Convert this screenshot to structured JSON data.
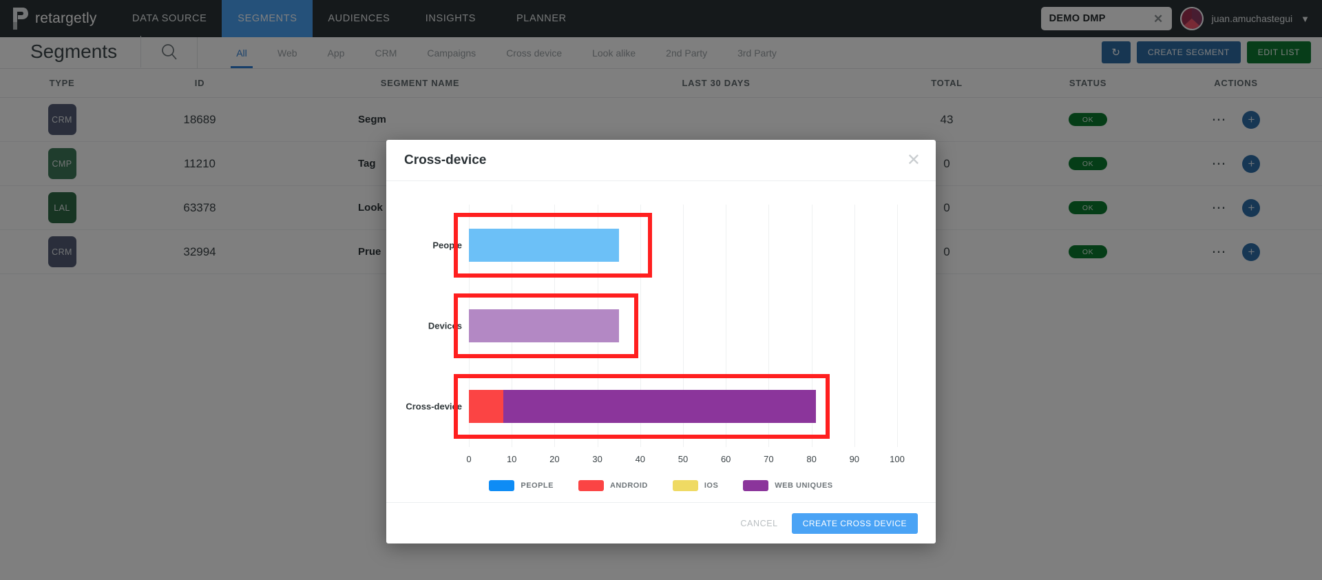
{
  "topnav": {
    "brand": "retargetly",
    "brand_icon": "retargetly-logo-icon",
    "items": [
      {
        "label": "DATA SOURCE",
        "active": false
      },
      {
        "label": "SEGMENTS",
        "active": true
      },
      {
        "label": "AUDIENCES",
        "active": false
      },
      {
        "label": "INSIGHTS",
        "active": false
      },
      {
        "label": "PLANNER",
        "active": false
      }
    ],
    "dmp_selector": {
      "value": "DEMO DMP",
      "clear_icon": "close-icon"
    },
    "user": {
      "name": "juan.amuchastegui",
      "chevron_icon": "chevron-down-icon",
      "avatar_icon": "avatar"
    }
  },
  "subheader": {
    "title": "Segments",
    "search_icon": "search-icon",
    "tabs": [
      {
        "label": "All",
        "active": true
      },
      {
        "label": "Web",
        "active": false
      },
      {
        "label": "App",
        "active": false
      },
      {
        "label": "CRM",
        "active": false
      },
      {
        "label": "Campaigns",
        "active": false
      },
      {
        "label": "Cross device",
        "active": false
      },
      {
        "label": "Look alike",
        "active": false
      },
      {
        "label": "2nd Party",
        "active": false
      },
      {
        "label": "3rd Party",
        "active": false
      }
    ],
    "refresh_icon": "refresh-icon",
    "create_segment_label": "CREATE SEGMENT",
    "edit_list_label": "EDIT LIST"
  },
  "table": {
    "columns": [
      "TYPE",
      "ID",
      "SEGMENT NAME",
      "LAST 30 DAYS",
      "TOTAL",
      "STATUS",
      "ACTIONS"
    ],
    "rows": [
      {
        "type": "CRM",
        "type_color": "#545d77",
        "id": "18689",
        "name": "Segm",
        "last30": "",
        "total": "43",
        "status": "OK"
      },
      {
        "type": "CMP",
        "type_color": "#3f7a5a",
        "id": "11210",
        "name": "Tag",
        "last30": "",
        "total": "0",
        "status": "OK"
      },
      {
        "type": "LAL",
        "type_color": "#2f6b47",
        "id": "63378",
        "name": "Look",
        "last30": "",
        "total": "0",
        "status": "OK"
      },
      {
        "type": "CRM",
        "type_color": "#545d77",
        "id": "32994",
        "name": "Prue",
        "last30": "",
        "total": "0",
        "status": "OK"
      }
    ],
    "row_menu_icon": "more-options-icon",
    "row_add_icon": "plus-icon"
  },
  "modal": {
    "title": "Cross-device",
    "close_icon": "close-icon",
    "cancel_label": "CANCEL",
    "submit_label": "CREATE CROSS DEVICE"
  },
  "chart_data": {
    "type": "bar",
    "orientation": "horizontal",
    "stacked": true,
    "title": "Cross-device",
    "categories": [
      "People",
      "Devices",
      "Cross-device"
    ],
    "xlabel": "",
    "ylabel": "",
    "xlim": [
      0,
      100
    ],
    "xticks": [
      0,
      10,
      20,
      30,
      40,
      50,
      60,
      70,
      80,
      90,
      100
    ],
    "grid": true,
    "legend": [
      {
        "name": "PEOPLE",
        "color": "#0e8cf5"
      },
      {
        "name": "ANDROID",
        "color": "#fb4444"
      },
      {
        "name": "IOS",
        "color": "#efda63"
      },
      {
        "name": "WEB UNIQUES",
        "color": "#8b359b"
      }
    ],
    "series": [
      {
        "name": "PEOPLE",
        "color": "#6cc0f7",
        "values": [
          35,
          0,
          0
        ]
      },
      {
        "name": "ANDROID",
        "color": "#fb4444",
        "values": [
          0,
          0,
          8
        ]
      },
      {
        "name": "IOS",
        "color": "#efda63",
        "values": [
          0,
          0,
          0
        ]
      },
      {
        "name": "WEB UNIQUES",
        "color": "#b388c4",
        "values": [
          0,
          35,
          73
        ]
      }
    ],
    "bars": [
      {
        "category": "People",
        "segments": [
          {
            "series": "PEOPLE",
            "color": "#6cc0f7",
            "start": 0,
            "value": 35
          }
        ],
        "highlighted": true
      },
      {
        "category": "Devices",
        "segments": [
          {
            "series": "WEB UNIQUES",
            "color": "#b388c4",
            "start": 0,
            "value": 35
          }
        ],
        "highlighted": true
      },
      {
        "category": "Cross-device",
        "segments": [
          {
            "series": "ANDROID",
            "color": "#fb4444",
            "start": 0,
            "value": 8
          },
          {
            "series": "WEB UNIQUES",
            "color": "#8b359b",
            "start": 8,
            "value": 73
          }
        ],
        "highlighted": true
      }
    ],
    "annotations": [
      {
        "type": "highlight-box",
        "target": "People",
        "color": "#ff1f1f"
      },
      {
        "type": "highlight-box",
        "target": "Devices",
        "color": "#ff1f1f"
      },
      {
        "type": "highlight-box",
        "target": "Cross-device",
        "color": "#ff1f1f"
      }
    ]
  },
  "colors": {
    "accent": "#4aa3f5",
    "header_bg": "#2b3336",
    "primary_button": "#2e6da4",
    "success": "#0f7a33",
    "highlight": "#ff1f1f"
  }
}
